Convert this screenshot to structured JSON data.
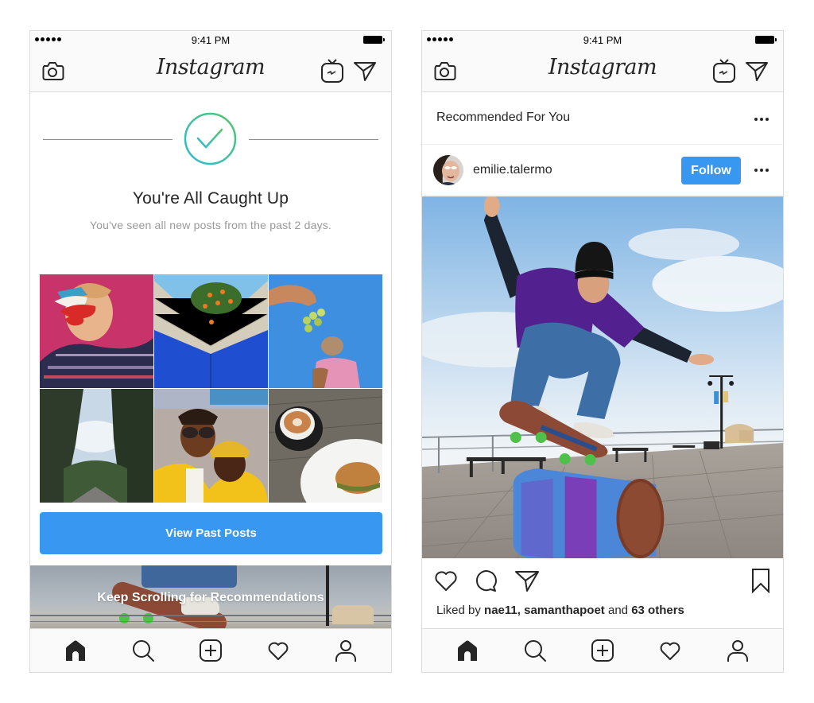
{
  "left_phone": {
    "status_bar": {
      "time": "9:41 PM",
      "signal_dots": 5
    },
    "nav": {
      "logo": "Instagram",
      "left_icon": "camera-icon",
      "right_icons": [
        "igtv-icon",
        "direct-message-icon"
      ]
    },
    "caught_up": {
      "icon": "checkmark-circle-icon",
      "title": "You're All Caught Up",
      "subtitle": "You've seen all new posts from the past 2 days."
    },
    "past_posts_grid": [
      {
        "description": "woman with stacked novelty sunglasses against pink wall"
      },
      {
        "description": "blue and cream brick wall corner with orange tree"
      },
      {
        "description": "hand holding grapes above small dog in pink outfit"
      },
      {
        "description": "tall pine trees along a road"
      },
      {
        "description": "two friends smiling in yellow jackets on boardwalk"
      },
      {
        "description": "latte and bitten burger on wooden table"
      }
    ],
    "view_past_button": "View Past Posts",
    "keep_scrolling_label": "Keep Scrolling for Recommendations",
    "tab_bar": [
      "home-icon",
      "search-icon",
      "new-post-icon",
      "activity-heart-icon",
      "profile-icon"
    ],
    "active_tab": "home"
  },
  "right_phone": {
    "status_bar": {
      "time": "9:41 PM",
      "signal_dots": 5
    },
    "nav": {
      "logo": "Instagram",
      "left_icon": "camera-icon",
      "right_icons": [
        "igtv-icon",
        "direct-message-icon"
      ]
    },
    "section_title": "Recommended For You",
    "post": {
      "username": "emilie.talermo",
      "follow_label": "Follow",
      "photo_description": "skateboarder jumping over painted barrel on boardwalk",
      "actions": [
        "like-icon",
        "comment-icon",
        "share-icon",
        "save-bookmark-icon"
      ],
      "likes": {
        "prefix": "Liked by ",
        "user1": "nae11",
        "sep": ", ",
        "user2": "samanthapoet",
        "and": " and ",
        "others": "63 others"
      }
    },
    "tab_bar": [
      "home-icon",
      "search-icon",
      "new-post-icon",
      "activity-heart-icon",
      "profile-icon"
    ],
    "active_tab": "home"
  },
  "colors": {
    "accent_blue": "#3897f0",
    "text_primary": "#262626",
    "text_secondary": "#999999",
    "bar_background": "#fafafa",
    "divider": "#dbdbdb",
    "check_gradient_start": "#2bbcd8",
    "check_gradient_end": "#59c36a"
  }
}
